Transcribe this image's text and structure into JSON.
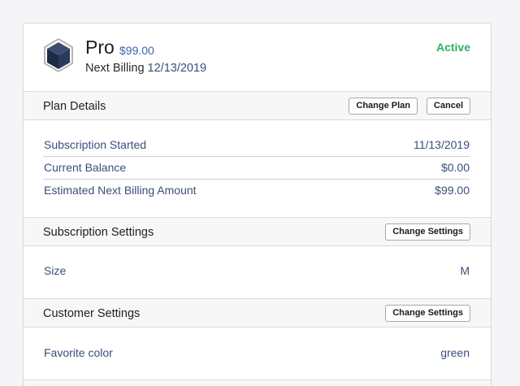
{
  "plan": {
    "name": "Pro",
    "price": "$99.00",
    "billing_label": "Next Billing",
    "billing_date": "12/13/2019",
    "status": "Active",
    "logo_icon": "cube-icon"
  },
  "plan_details": {
    "title": "Plan Details",
    "change_plan_label": "Change Plan",
    "cancel_label": "Cancel",
    "rows": [
      {
        "label": "Subscription Started",
        "value": "11/13/2019"
      },
      {
        "label": "Current Balance",
        "value": "$0.00"
      },
      {
        "label": "Estimated Next Billing Amount",
        "value": "$99.00"
      }
    ]
  },
  "subscription_settings": {
    "title": "Subscription Settings",
    "button_label": "Change Settings",
    "rows": [
      {
        "label": "Size",
        "value": "M"
      }
    ]
  },
  "customer_settings": {
    "title": "Customer Settings",
    "button_label": "Change Settings",
    "rows": [
      {
        "label": "Favorite color",
        "value": "green"
      }
    ]
  },
  "colors": {
    "accent": "#3a62a8",
    "status_active": "#2ab463",
    "text_value": "#3a4f7a"
  }
}
